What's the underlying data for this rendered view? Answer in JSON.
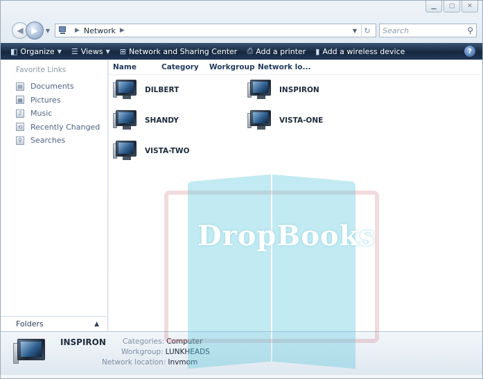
{
  "window": {
    "caption_buttons": [
      "minimize",
      "maximize",
      "close"
    ]
  },
  "address": {
    "crumb": "Network",
    "search_placeholder": "Search"
  },
  "toolbar": {
    "organize": "Organize",
    "views": "Views",
    "network_center": "Network and Sharing Center",
    "add_printer": "Add a printer",
    "add_wireless": "Add a wireless device"
  },
  "nav": {
    "heading": "Favorite Links",
    "items": [
      {
        "label": "Documents",
        "icon": "documents-icon"
      },
      {
        "label": "Pictures",
        "icon": "pictures-icon"
      },
      {
        "label": "Music",
        "icon": "music-icon"
      },
      {
        "label": "Recently Changed",
        "icon": "recent-icon"
      },
      {
        "label": "Searches",
        "icon": "searches-icon"
      }
    ],
    "folders_label": "Folders"
  },
  "columns": [
    "Name",
    "Category",
    "Workgroup",
    "Network lo..."
  ],
  "computers": [
    "DILBERT",
    "INSPIRON",
    "SHANDY",
    "VISTA-ONE",
    "VISTA-TWO"
  ],
  "details": {
    "name": "INSPIRON",
    "categories_label": "Categories:",
    "categories_value": "Computer",
    "workgroup_label": "Workgroup:",
    "workgroup_value": "LUNKHEADS",
    "location_label": "Network location:",
    "location_value": "Invmom"
  },
  "watermark": {
    "text": "DropBooks"
  }
}
